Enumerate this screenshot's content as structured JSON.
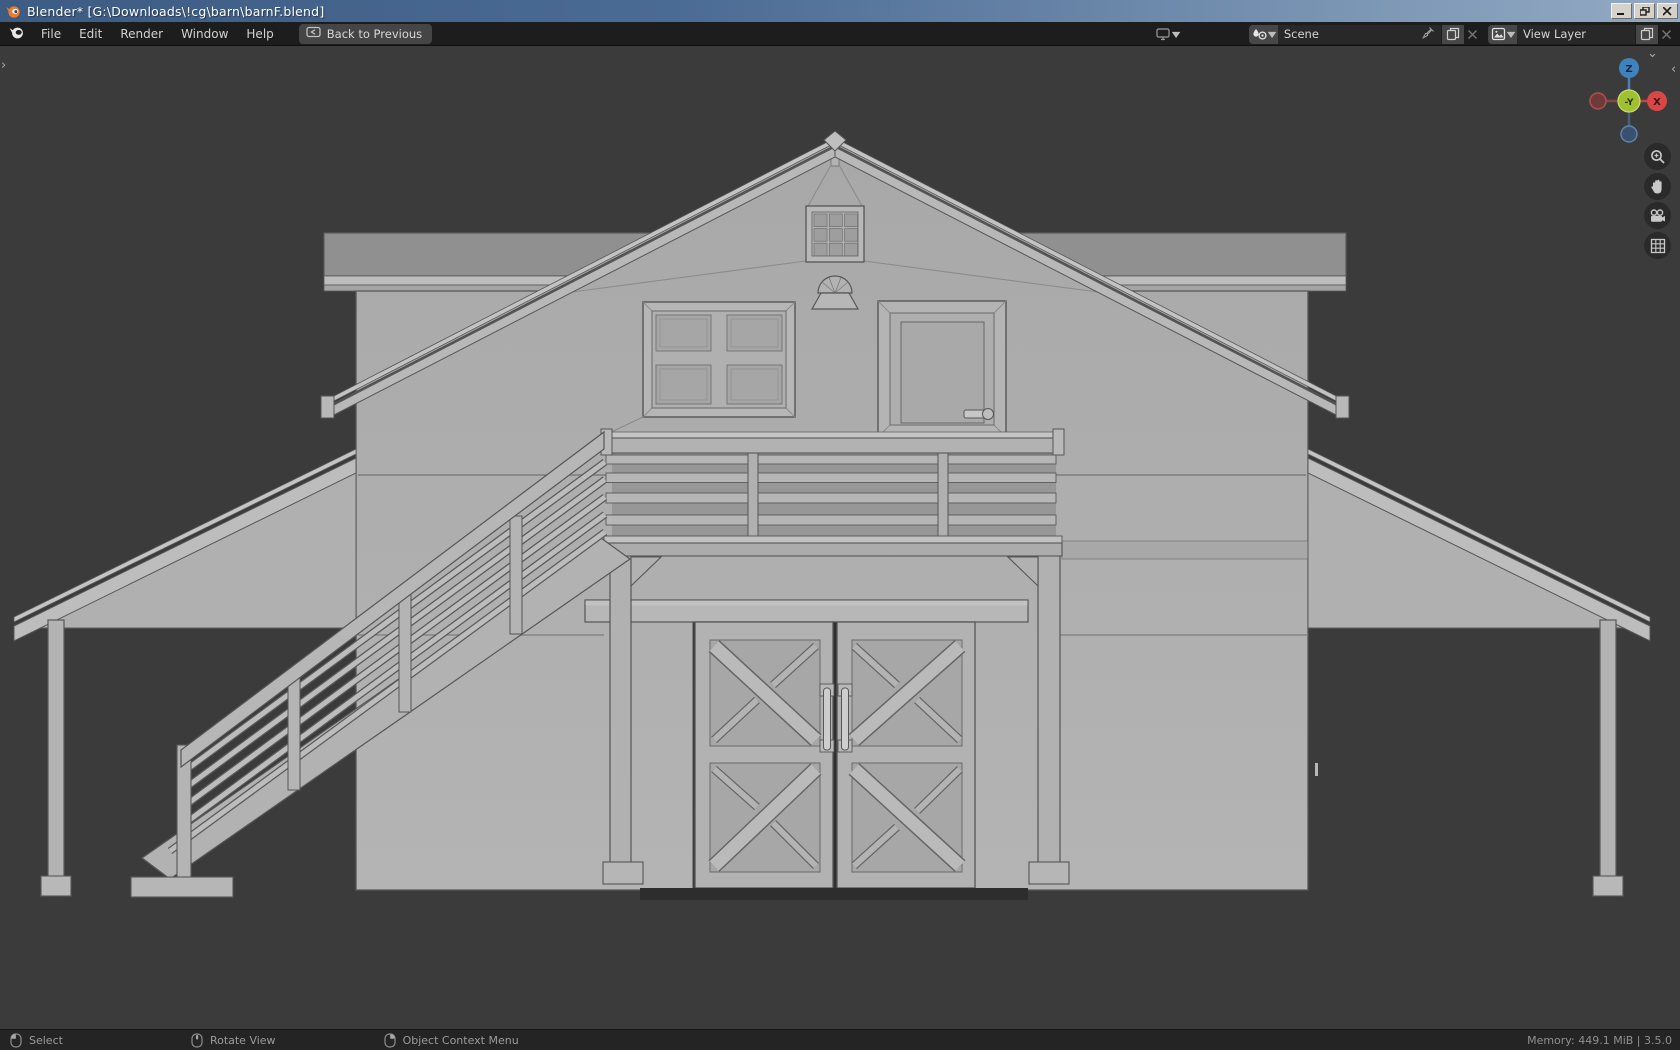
{
  "window": {
    "title": "Blender* [G:\\Downloads\\!cg\\barn\\barnF.blend]"
  },
  "menubar": {
    "items": [
      "File",
      "Edit",
      "Render",
      "Window",
      "Help"
    ],
    "back_button": "Back to Previous"
  },
  "topbar_right": {
    "scene_label": "Scene",
    "view_layer_label": "View Layer"
  },
  "viewport": {
    "gizmo": {
      "z": "Z",
      "x": "X",
      "center": "-Y"
    }
  },
  "statusbar": {
    "select": "Select",
    "rotate": "Rotate View",
    "context_menu": "Object Context Menu",
    "memory": "Memory: 449.1 MiB | 3.5.0"
  },
  "colors": {
    "titlebar_left": "#3d5c84",
    "titlebar_right": "#93aac4",
    "topbar_bg": "#1d1d1d",
    "viewport_bg": "#3b3b3b",
    "statusbar_bg": "#242424",
    "wall": "#aeaeae",
    "trim": "#bcbcbc",
    "roof_top": "#8f8f8f",
    "outline": "#555555",
    "axis_x": "#d94646",
    "axis_y": "#9fc131",
    "axis_z": "#3f83bd"
  }
}
